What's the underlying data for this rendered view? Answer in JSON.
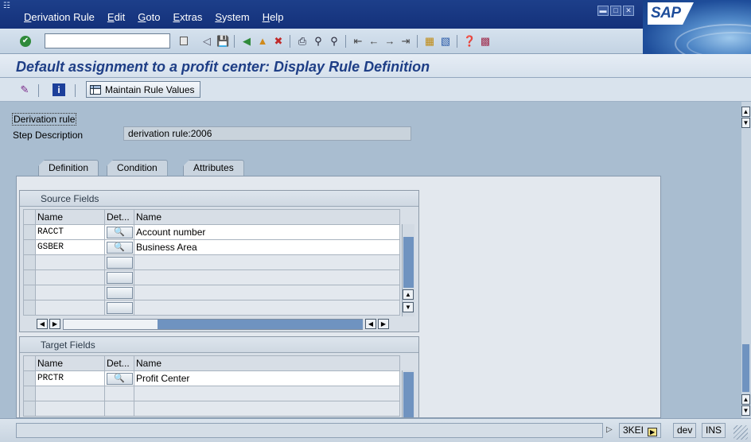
{
  "menubar": {
    "items": [
      "Derivation Rule",
      "Edit",
      "Goto",
      "Extras",
      "System",
      "Help"
    ],
    "logo": "SAP"
  },
  "toolbar": {
    "command_field_value": "",
    "icons": [
      "enter-icon",
      "back-icon",
      "save-icon",
      "back-nav-icon",
      "exit-icon",
      "cancel-icon",
      "print-icon",
      "find-icon",
      "find-next-icon",
      "first-page-icon",
      "prev-page-icon",
      "next-page-icon",
      "last-page-icon",
      "create-session-icon",
      "shortcut-icon",
      "help-icon",
      "layout-icon"
    ]
  },
  "page": {
    "title": "Default assignment to a profit center: Display Rule Definition"
  },
  "app_toolbar": {
    "maintain_label": "Maintain Rule Values"
  },
  "form": {
    "derivation_rule_label": "Derivation rule",
    "step_description_label": "Step Description",
    "step_description_value": "derivation rule:2006"
  },
  "tabs": [
    {
      "label": "Definition",
      "active": true
    },
    {
      "label": "Condition",
      "active": false
    },
    {
      "label": "Attributes",
      "active": false
    }
  ],
  "source_fields": {
    "title": "Source Fields",
    "columns": [
      "Name",
      "Det...",
      "Name"
    ],
    "rows": [
      {
        "field": "RACCT",
        "desc": "Account number"
      },
      {
        "field": "GSBER",
        "desc": "Business Area"
      }
    ]
  },
  "target_fields": {
    "title": "Target Fields",
    "columns": [
      "Name",
      "Det...",
      "Name"
    ],
    "rows": [
      {
        "field": "PRCTR",
        "desc": "Profit Center"
      }
    ]
  },
  "statusbar": {
    "system": "3KEI",
    "client": "dev",
    "mode": "INS"
  },
  "colors": {
    "background": "#a9bdd0",
    "title_text": "#1e3e86",
    "menubar": "#1d3f8a"
  }
}
